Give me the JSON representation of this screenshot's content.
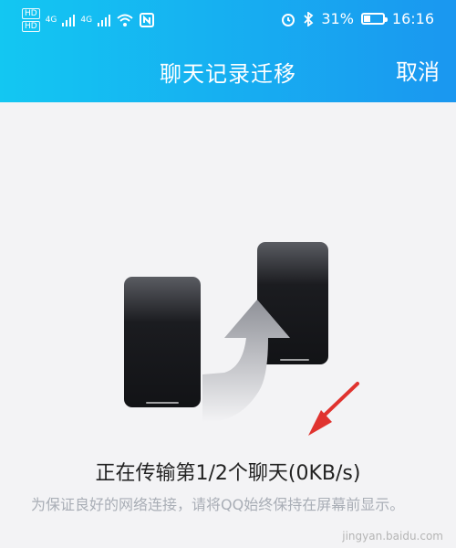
{
  "status": {
    "hd1": "HD",
    "hd2": "HD",
    "net1": "4G",
    "net2": "4G",
    "battery": "31%",
    "time": "16:16"
  },
  "header": {
    "title": "聊天记录迁移",
    "cancel": "取消"
  },
  "progress": {
    "message": "正在传输第1/2个聊天(0KB/s)"
  },
  "hint": {
    "text": "为保证良好的网络连接，请将QQ始终保持在屏幕前显示。"
  },
  "watermark": {
    "text": "jingyan.baidu.com"
  },
  "colors": {
    "header_gradient_start": "#13c7f2",
    "header_gradient_end": "#1a97f0",
    "arrow": "#e0332f",
    "phone_dark": "#1b1c20"
  },
  "icons": [
    "hd-icon",
    "signal-icon",
    "wifi-icon",
    "nfc-icon",
    "alarm-icon",
    "bluetooth-icon",
    "battery-icon",
    "phone-icon",
    "upload-arrow-icon",
    "annotation-arrow-icon"
  ]
}
